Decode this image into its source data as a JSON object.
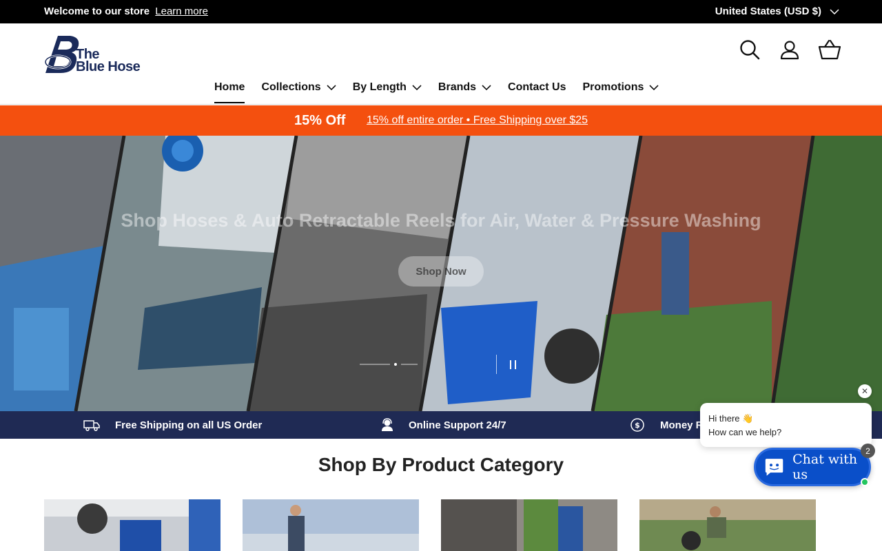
{
  "announcement": {
    "welcome": "Welcome to our store",
    "learn_more": "Learn more",
    "country": "United States (USD $)"
  },
  "brand": {
    "logo_line1": "The",
    "logo_line2": "Blue Hose",
    "color": "#1a2a5a"
  },
  "header_icons": [
    "search-icon",
    "account-icon",
    "cart-icon"
  ],
  "nav": {
    "items": [
      {
        "label": "Home",
        "active": true
      },
      {
        "label": "Collections",
        "dropdown": true
      },
      {
        "label": "By Length",
        "dropdown": true
      },
      {
        "label": "Brands",
        "dropdown": true
      },
      {
        "label": "Contact Us"
      },
      {
        "label": "Promotions",
        "dropdown": true
      }
    ]
  },
  "promo": {
    "highlight": "15% Off",
    "message": "15% off entire order • Free Shipping over $25",
    "color": "#f4500f"
  },
  "hero": {
    "title": "Shop Hoses & Auto Retractable Reels for Air, Water & Pressure Washing",
    "button": "Shop Now"
  },
  "features": [
    {
      "icon": "truck-icon",
      "label": "Free Shipping on all US Order"
    },
    {
      "icon": "support-icon",
      "label": "Online Support 24/7"
    },
    {
      "icon": "money-icon",
      "label": "Money R"
    }
  ],
  "category_section": {
    "title": "Shop By Product Category"
  },
  "chat": {
    "greeting": "Hi there 👋",
    "prompt": "How can we help?",
    "button": "Chat with us",
    "badge": "2",
    "close": "✕",
    "color": "#0a4fc9"
  }
}
